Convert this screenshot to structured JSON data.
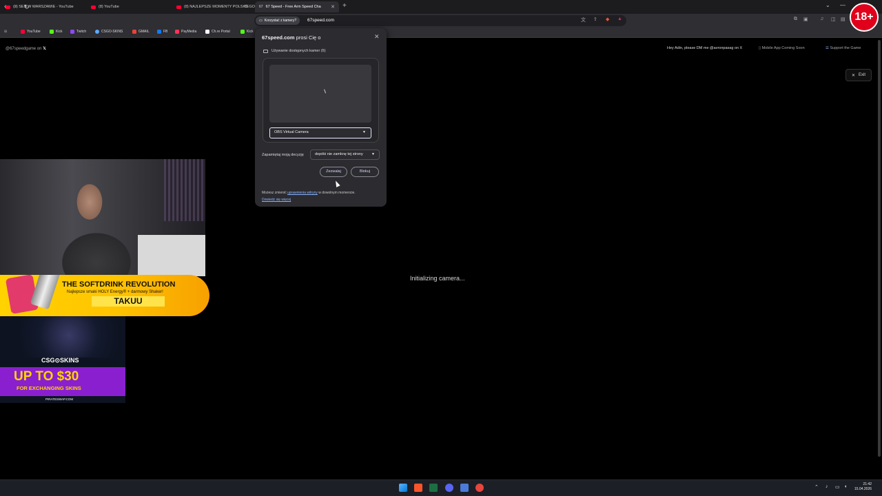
{
  "tabs": [
    {
      "title": "(8) SEN W WARSZAWIE - YouTube",
      "active": false
    },
    {
      "title": "(8) YouTube",
      "active": false
    },
    {
      "title": "(8) NAJLEPSZE MOMENTY POLSKIEGO",
      "active": false
    },
    {
      "title": "67 Speed - Free Arm Speed Cha",
      "active": true
    }
  ],
  "address_bar": {
    "permission_chip": "Korzystać z kamery?",
    "url": "67speed.com"
  },
  "bookmarks": [
    {
      "label": "YouTube",
      "color": "#ff0033"
    },
    {
      "label": "Kick",
      "color": "#53fc18"
    },
    {
      "label": "Twitch",
      "color": "#9146ff"
    },
    {
      "label": "CSGO-SKINS",
      "color": "#5fa8ff"
    },
    {
      "label": "GMAIL",
      "color": "#ea4335"
    },
    {
      "label": "FB",
      "color": "#1877f2"
    },
    {
      "label": "PayMedia",
      "color": "#ff3355"
    },
    {
      "label": "Ch.re Portal",
      "color": "#ffffff"
    },
    {
      "label": "Kick",
      "color": "#53fc18"
    }
  ],
  "page": {
    "handle": "@67speedgame on",
    "x_icon": "x-logo-icon",
    "dm_message": "Hey Adin, please DM me @avronpasag on X",
    "mobile_app": "Mobile App Coming Soon",
    "support": "Support the Game",
    "exit_label": "Exit",
    "status": "Initializing camera..."
  },
  "permission_popup": {
    "site": "67speed.com",
    "request": "prosi Cię o",
    "camera_usage": "Używanie dostępnych kamer (6)",
    "camera_selected": "OBS Virtual Camera",
    "remember_label": "Zapamiętaj moją decyzję",
    "remember_value": "dopóki nie zamknę tej strony",
    "allow_label": "Zezwalaj",
    "block_label": "Blokuj",
    "footer_prefix": "Możesz zmienić",
    "footer_link": "uprawnienia witryny",
    "footer_suffix": "w dowolnym momencie.",
    "learn_more": "Dowiedz się więcej"
  },
  "sponsor": {
    "headline": "THE SOFTDRINK REVOLUTION",
    "subline": "Najlepsze smaki HOLY Energy® + darmowy Shaker!",
    "code": "TAKUU",
    "brand_color": "#ffd200"
  },
  "ad2": {
    "brand": "CSG⊙SKINS",
    "offer": "UP TO $30",
    "offer_sub": "FOR EXCHANGING SKINS",
    "site": "PIRATESWAP.COM"
  },
  "badge": "18+",
  "clock": {
    "time": "21:42",
    "date": "15.04.2026"
  }
}
